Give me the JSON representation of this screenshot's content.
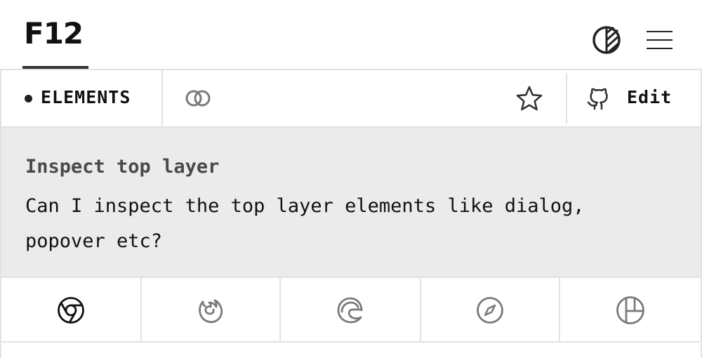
{
  "header": {
    "logo_text": "F12",
    "theme_toggle_icon": "contrast-icon",
    "menu_icon": "hamburger-menu-icon"
  },
  "toolbar": {
    "category_label": "ELEMENTS",
    "link_icon": "link-icon",
    "favorite_icon": "star-icon",
    "edit_label": "Edit",
    "edit_icon": "github-icon"
  },
  "panel": {
    "title": "Inspect top layer",
    "description": "Can I inspect the top layer elements like dialog, popover etc?"
  },
  "browsers": [
    {
      "name": "chrome",
      "icon": "chrome-icon",
      "selected": true
    },
    {
      "name": "firefox",
      "icon": "firefox-icon",
      "selected": false
    },
    {
      "name": "edge",
      "icon": "edge-icon",
      "selected": false
    },
    {
      "name": "safari",
      "icon": "safari-icon",
      "selected": false
    },
    {
      "name": "polypane",
      "icon": "polypane-icon",
      "selected": false
    }
  ],
  "colors": {
    "text": "#111111",
    "muted_icon": "#7a7a7a",
    "panel_bg": "#ebebeb",
    "border": "#e2e2e2",
    "title_text": "#4a4a4a"
  }
}
